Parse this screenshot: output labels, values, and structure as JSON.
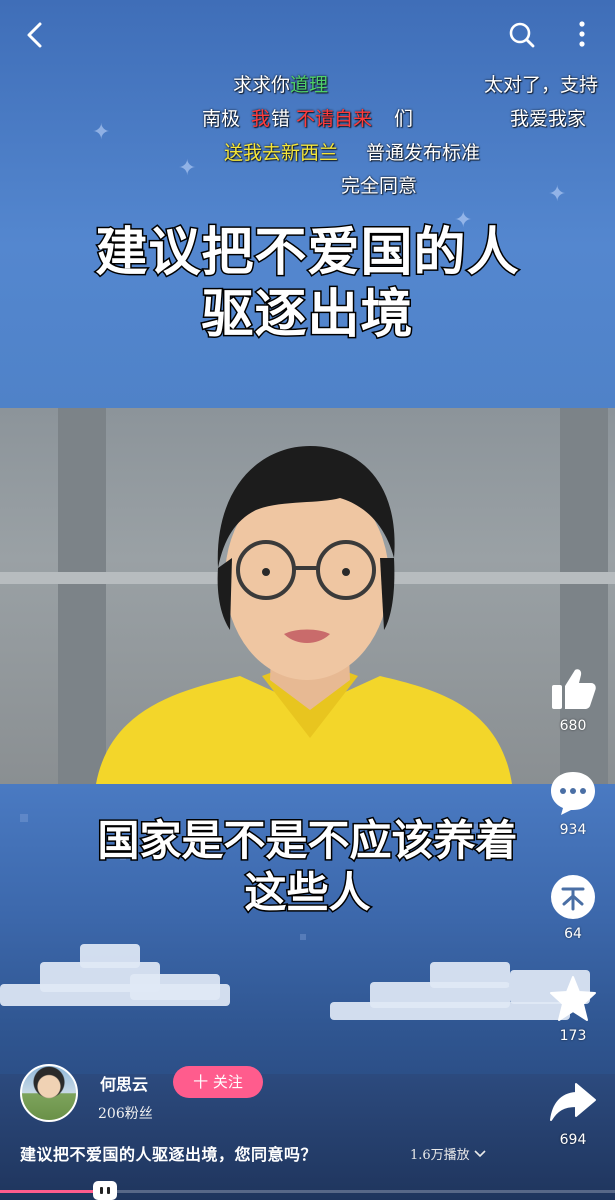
{
  "header": {
    "back_icon": "back-arrow-icon",
    "search_icon": "search-icon",
    "more_icon": "more-vertical-icon"
  },
  "danmaku": [
    {
      "text": "求求你",
      "color": "#ffffff"
    },
    {
      "text": "道理",
      "color": "#4fd06a"
    },
    {
      "text": "太对了，支持",
      "color": "#ffffff"
    },
    {
      "text": "南极",
      "color": "#ffffff"
    },
    {
      "text": "我",
      "color": "#ff3b3b"
    },
    {
      "text": "错",
      "color": "#ffffff"
    },
    {
      "text": "不请自来",
      "color": "#ff3b3b"
    },
    {
      "text": "们",
      "color": "#ffffff"
    },
    {
      "text": "我爱我家",
      "color": "#ffffff"
    },
    {
      "text": "送我去新西兰",
      "color": "#f5e63a"
    },
    {
      "text": "普通发布标准",
      "color": "#ffffff"
    },
    {
      "text": "完全同意",
      "color": "#ffffff"
    }
  ],
  "video": {
    "title_line1": "建议把不爱国的人",
    "title_line2": "驱逐出境",
    "subtitle_line1": "国家是不是不应该养着",
    "subtitle_line2": "这些人"
  },
  "actions": {
    "like": {
      "icon": "thumbs-up-icon",
      "count": "680"
    },
    "comment": {
      "icon": "comment-bubble-icon",
      "count": "934"
    },
    "coin": {
      "icon": "coin-icon",
      "count": "64"
    },
    "favorite": {
      "icon": "star-icon",
      "count": "173"
    },
    "share": {
      "icon": "share-arrow-icon",
      "count": "694"
    }
  },
  "author": {
    "name": "何思云",
    "followers": "206粉丝",
    "follow_label": "十 关注"
  },
  "caption": "建议把不爱国的人驱逐出境，您同意吗？",
  "plays": "1.6万播放",
  "progress": {
    "fraction": 0.17
  },
  "colors": {
    "accent": "#ff5c8d",
    "sky": "#4a7ac2"
  }
}
